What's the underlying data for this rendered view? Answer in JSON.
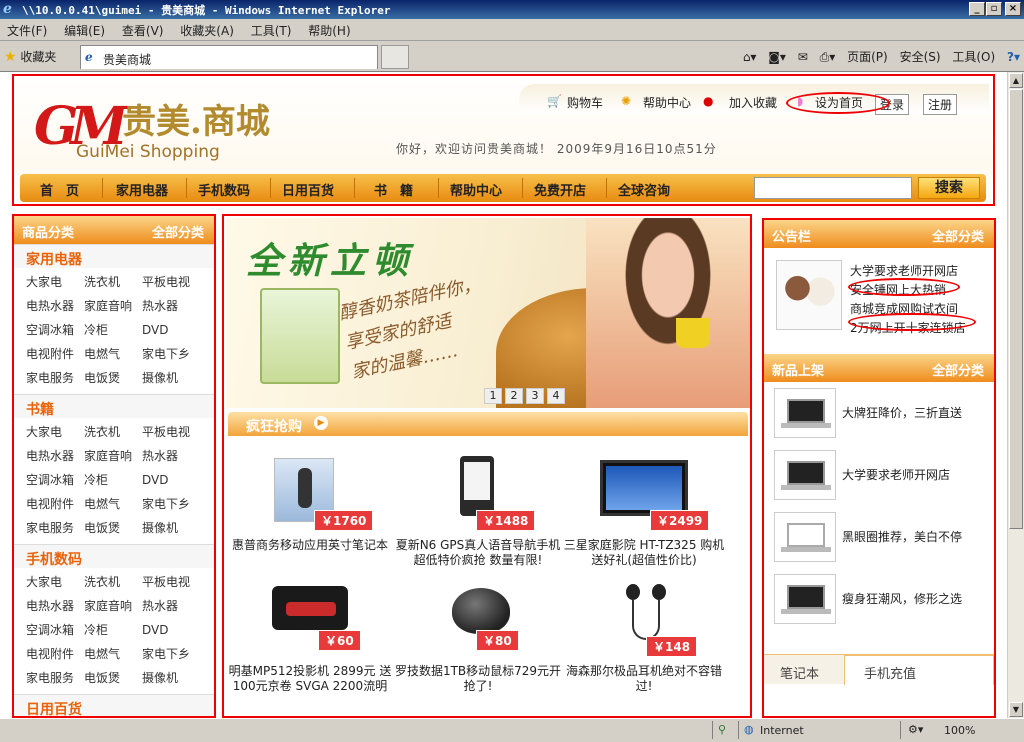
{
  "window": {
    "title": "\\\\10.0.0.41\\guimei - 贵美商城 - Windows Internet Explorer",
    "menu": [
      "文件(F)",
      "编辑(E)",
      "查看(V)",
      "收藏夹(A)",
      "工具(T)",
      "帮助(H)"
    ],
    "favorites_label": "收藏夹",
    "tab_title": "贵美商城",
    "commands": [
      "页面(P)",
      "安全(S)",
      "工具(O)"
    ],
    "status_zone": "Internet",
    "zoom": "100%"
  },
  "header": {
    "logo_cn": "贵美.商城",
    "logo_en": "GuiMei Shopping",
    "logo_mark": "GM",
    "links": {
      "cart": "购物车",
      "help": "帮助中心",
      "favorite": "加入收藏",
      "homepage": "设为首页",
      "login": "登录",
      "register": "注册"
    },
    "welcome": "你好，欢迎访问贵美商城！ 2009年9月16日10点51分",
    "nav": [
      "首　页",
      "家用电器",
      "手机数码",
      "日用百货",
      "书　籍",
      "帮助中心",
      "免费开店",
      "全球咨询"
    ],
    "search_button": "搜索"
  },
  "left": {
    "title": "商品分类",
    "all": "全部分类",
    "categories": [
      {
        "name": "家用电器",
        "items": [
          "大家电",
          "洗衣机",
          "平板电视",
          "电热水器",
          "家庭音响",
          "热水器",
          "空调冰箱",
          "冷柜",
          "DVD",
          "电视附件",
          "电燃气",
          "家电下乡",
          "家电服务",
          "电饭煲",
          "摄像机"
        ]
      },
      {
        "name": "书籍",
        "items": [
          "大家电",
          "洗衣机",
          "平板电视",
          "电热水器",
          "家庭音响",
          "热水器",
          "空调冰箱",
          "冷柜",
          "DVD",
          "电视附件",
          "电燃气",
          "家电下乡",
          "家电服务",
          "电饭煲",
          "摄像机"
        ]
      },
      {
        "name": "手机数码",
        "items": [
          "大家电",
          "洗衣机",
          "平板电视",
          "电热水器",
          "家庭音响",
          "热水器",
          "空调冰箱",
          "冷柜",
          "DVD",
          "电视附件",
          "电燃气",
          "家电下乡",
          "家电服务",
          "电饭煲",
          "摄像机"
        ]
      },
      {
        "name": "日用百货",
        "items": []
      }
    ]
  },
  "banner": {
    "headline": "全新立顿",
    "poem": [
      "醇香奶茶陪伴你，",
      "享受家的舒适",
      "家的温馨……"
    ],
    "pages": [
      "1",
      "2",
      "3",
      "4"
    ]
  },
  "sale": {
    "title": "疯狂抢购",
    "products": [
      {
        "price": "￥1760",
        "name": "惠普商务移动应用英寸笔记本"
      },
      {
        "price": "￥1488",
        "name": "夏新N6 GPS真人语音导航手机超低特价疯抢 数量有限!"
      },
      {
        "price": "￥2499",
        "name": "三星家庭影院 HT-TZ325 购机送好礼(超值性价比)"
      },
      {
        "price": "￥60",
        "name": "明基MP512投影机 2899元 送100元京卷 SVGA 2200流明"
      },
      {
        "price": "￥80",
        "name": "罗技数据1TB移动鼠标729元开抢了!"
      },
      {
        "price": "￥148",
        "name": "海森那尔极品耳机绝对不容错过!"
      }
    ]
  },
  "notice": {
    "title": "公告栏",
    "all": "全部分类",
    "items": [
      "大学要求老师开网店",
      "安全锤网上大热销",
      "商城竞成网购试衣间",
      "2万网上开十家连锁店"
    ]
  },
  "new_products": {
    "title": "新品上架",
    "all": "全部分类",
    "items": [
      "大牌狂降价，三折直送",
      "大学要求老师开网店",
      "黑眼圈推荐，美白不停",
      "瘦身狂潮风，修形之选"
    ]
  },
  "tabs": [
    "笔记本",
    "手机充值"
  ],
  "colors": {
    "accent": "#ef8c1c",
    "highlight": "#e00000",
    "brand_red": "#d41717",
    "brand_gold": "#b38b2f"
  }
}
